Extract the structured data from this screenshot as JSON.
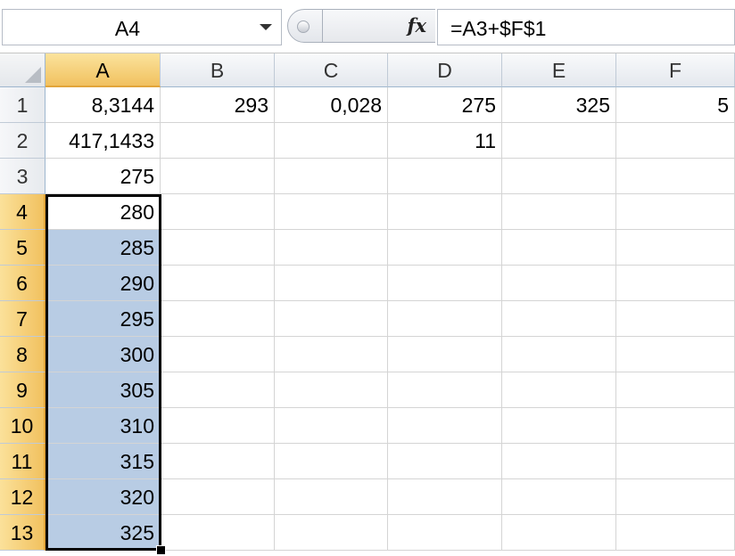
{
  "name_box": {
    "value": "A4"
  },
  "formula_bar": {
    "fx_label": "fx",
    "formula": "=A3+$F$1"
  },
  "columns": [
    "A",
    "B",
    "C",
    "D",
    "E",
    "F"
  ],
  "rows": [
    {
      "num": "1",
      "cells": [
        "8,3144",
        "293",
        "0,028",
        "275",
        "325",
        "5"
      ]
    },
    {
      "num": "2",
      "cells": [
        "417,1433",
        "",
        "",
        "11",
        "",
        ""
      ]
    },
    {
      "num": "3",
      "cells": [
        "275",
        "",
        "",
        "",
        "",
        ""
      ]
    },
    {
      "num": "4",
      "cells": [
        "280",
        "",
        "",
        "",
        "",
        ""
      ]
    },
    {
      "num": "5",
      "cells": [
        "285",
        "",
        "",
        "",
        "",
        ""
      ]
    },
    {
      "num": "6",
      "cells": [
        "290",
        "",
        "",
        "",
        "",
        ""
      ]
    },
    {
      "num": "7",
      "cells": [
        "295",
        "",
        "",
        "",
        "",
        ""
      ]
    },
    {
      "num": "8",
      "cells": [
        "300",
        "",
        "",
        "",
        "",
        ""
      ]
    },
    {
      "num": "9",
      "cells": [
        "305",
        "",
        "",
        "",
        "",
        ""
      ]
    },
    {
      "num": "10",
      "cells": [
        "310",
        "",
        "",
        "",
        "",
        ""
      ]
    },
    {
      "num": "11",
      "cells": [
        "315",
        "",
        "",
        "",
        "",
        ""
      ]
    },
    {
      "num": "12",
      "cells": [
        "320",
        "",
        "",
        "",
        "",
        ""
      ]
    },
    {
      "num": "13",
      "cells": [
        "325",
        "",
        "",
        "",
        "",
        ""
      ]
    }
  ],
  "selection": {
    "active_cell": "A4",
    "range": "A4:A13"
  },
  "colors": {
    "selection_fill": "#b8cce4",
    "header_highlight": "#f1c15f",
    "gridline": "#d4d4d4"
  }
}
